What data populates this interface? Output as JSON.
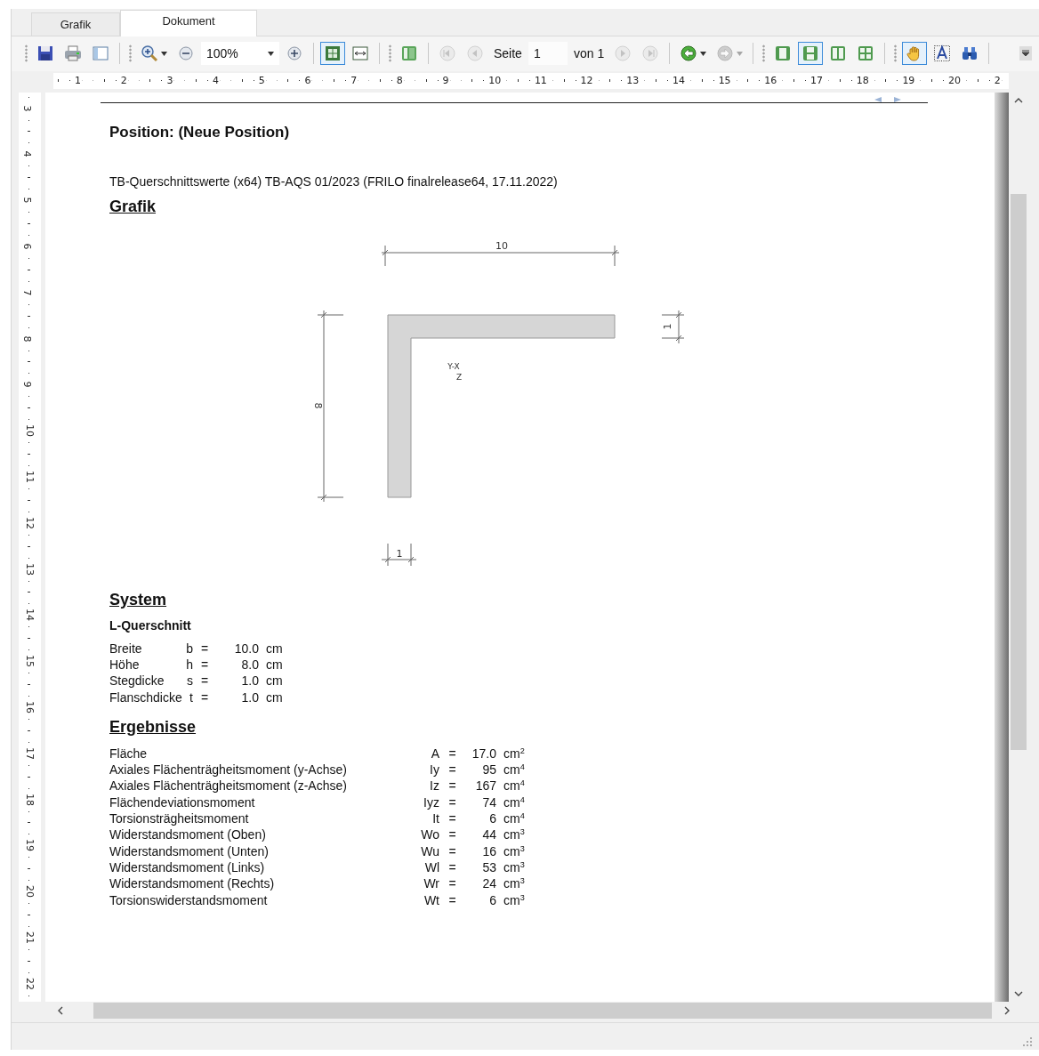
{
  "tabs": [
    {
      "label": "Grafik",
      "selected": false
    },
    {
      "label": "Dokument",
      "selected": true
    }
  ],
  "toolbar": {
    "items": [
      {
        "kind": "grip"
      },
      {
        "kind": "save",
        "selected": false,
        "disabled": false,
        "dropdown": false
      },
      {
        "kind": "print",
        "selected": false,
        "disabled": false,
        "dropdown": false
      },
      {
        "kind": "sidebar",
        "selected": false,
        "disabled": false,
        "dropdown": false
      },
      {
        "kind": "separator"
      },
      {
        "kind": "grip"
      },
      {
        "kind": "magnifier",
        "selected": false,
        "disabled": false,
        "dropdown": true
      },
      {
        "kind": "zoom-out",
        "selected": false,
        "disabled": false,
        "dropdown": false
      },
      {
        "kind": "zoom-field",
        "value": "100%"
      },
      {
        "kind": "zoom-in",
        "selected": false,
        "disabled": false,
        "dropdown": false
      },
      {
        "kind": "separator"
      },
      {
        "kind": "fit-page",
        "selected": true,
        "disabled": false,
        "dropdown": false
      },
      {
        "kind": "fit-width",
        "selected": false,
        "disabled": false,
        "dropdown": false
      },
      {
        "kind": "separator"
      },
      {
        "kind": "grip"
      },
      {
        "kind": "thumbnails",
        "selected": false,
        "disabled": false,
        "dropdown": false
      },
      {
        "kind": "separator"
      },
      {
        "kind": "first",
        "selected": false,
        "disabled": true,
        "dropdown": false
      },
      {
        "kind": "previous",
        "selected": false,
        "disabled": true,
        "dropdown": false
      },
      {
        "kind": "label",
        "text": "Seite"
      },
      {
        "kind": "page-field",
        "value": "1"
      },
      {
        "kind": "label",
        "text": "von 1"
      },
      {
        "kind": "next",
        "selected": false,
        "disabled": true,
        "dropdown": false
      },
      {
        "kind": "last",
        "selected": false,
        "disabled": true,
        "dropdown": false
      },
      {
        "kind": "separator"
      },
      {
        "kind": "back",
        "selected": false,
        "disabled": false,
        "dropdown": true
      },
      {
        "kind": "forward",
        "selected": false,
        "disabled": true,
        "dropdown": true
      },
      {
        "kind": "separator"
      },
      {
        "kind": "grip"
      },
      {
        "kind": "single",
        "selected": false,
        "disabled": false,
        "dropdown": false
      },
      {
        "kind": "continuous",
        "selected": true,
        "disabled": false,
        "dropdown": false
      },
      {
        "kind": "facing",
        "selected": false,
        "disabled": false,
        "dropdown": false
      },
      {
        "kind": "multi",
        "selected": false,
        "disabled": false,
        "dropdown": false
      },
      {
        "kind": "separator"
      },
      {
        "kind": "grip"
      },
      {
        "kind": "hand",
        "selected": true,
        "disabled": false,
        "dropdown": false
      },
      {
        "kind": "text",
        "selected": false,
        "disabled": false,
        "dropdown": false
      },
      {
        "kind": "find",
        "selected": false,
        "disabled": false,
        "dropdown": false
      },
      {
        "kind": "separator"
      },
      {
        "kind": "overflow"
      }
    ]
  },
  "ruler": {
    "horizontal": [
      "1",
      "2",
      "3",
      "4",
      "5",
      "6",
      "7",
      "8",
      "9",
      "10",
      "11",
      "12",
      "13",
      "14",
      "15",
      "16",
      "17",
      "18",
      "19",
      "20",
      "2"
    ],
    "vertical": [
      "3",
      "4",
      "5",
      "6",
      "7",
      "8",
      "9",
      "10",
      "11",
      "12",
      "13",
      "14",
      "15",
      "16",
      "17",
      "18",
      "19",
      "20",
      "21",
      "22"
    ]
  },
  "document": {
    "heading": "Position: (Neue Position)",
    "program": "TB-Querschnittswerte (x64) TB-AQS 01/2023 (FRILO finalrelease64, 17.11.2022)",
    "graphic_title": "Grafik",
    "drawing": {
      "width_label": "10",
      "height_label": "8",
      "flange_label": "1",
      "web_label": "1",
      "axis_label": "Y-X",
      "axis_label_2": "Z"
    },
    "system": {
      "title": "System",
      "subtitle": "L-Querschnitt",
      "rows": [
        {
          "label": "Breite",
          "symbol": "b",
          "relation": "=",
          "value": "10.0",
          "unit": "cm"
        },
        {
          "label": "Höhe",
          "symbol": "h",
          "relation": "=",
          "value": "8.0",
          "unit": "cm"
        },
        {
          "label": "Stegdicke",
          "symbol": "s",
          "relation": "=",
          "value": "1.0",
          "unit": "cm"
        },
        {
          "label": "Flanschdicke",
          "symbol": "t",
          "relation": "=",
          "value": "1.0",
          "unit": "cm"
        }
      ]
    },
    "results": {
      "title": "Ergebnisse",
      "rows": [
        {
          "label": "Fläche",
          "symbol": "A",
          "relation": "=",
          "value": "17.0",
          "unit": "cm$^{2}$"
        },
        {
          "label": "Axiales Flächenträgheitsmoment (y-Achse)",
          "symbol": "Iy",
          "relation": "=",
          "value": "95",
          "unit": "cm$^{4}$"
        },
        {
          "label": "Axiales Flächenträgheitsmoment (z-Achse)",
          "symbol": "Iz",
          "relation": "=",
          "value": "167",
          "unit": "cm$^{4}$"
        },
        {
          "label": "Flächendeviationsmoment",
          "symbol": "Iyz",
          "relation": "=",
          "value": "74",
          "unit": "cm$^{4}$"
        },
        {
          "label": "Torsionsträgheitsmoment",
          "symbol": "It",
          "relation": "=",
          "value": "6",
          "unit": "cm$^{4}$"
        },
        {
          "label": "Widerstandsmoment (Oben)",
          "symbol": "Wo",
          "relation": "=",
          "value": "44",
          "unit": "cm$^{3}$"
        },
        {
          "label": "Widerstandsmoment (Unten)",
          "symbol": "Wu",
          "relation": "=",
          "value": "16",
          "unit": "cm$^{3}$"
        },
        {
          "label": "Widerstandsmoment (Links)",
          "symbol": "Wl",
          "relation": "=",
          "value": "53",
          "unit": "cm$^{3}$"
        },
        {
          "label": "Widerstandsmoment (Rechts)",
          "symbol": "Wr",
          "relation": "=",
          "value": "24",
          "unit": "cm$^{3}$"
        },
        {
          "label": "Torsionswiderstandsmoment",
          "symbol": "Wt",
          "relation": "=",
          "value": "6",
          "unit": "cm$^{3}$"
        }
      ]
    }
  }
}
